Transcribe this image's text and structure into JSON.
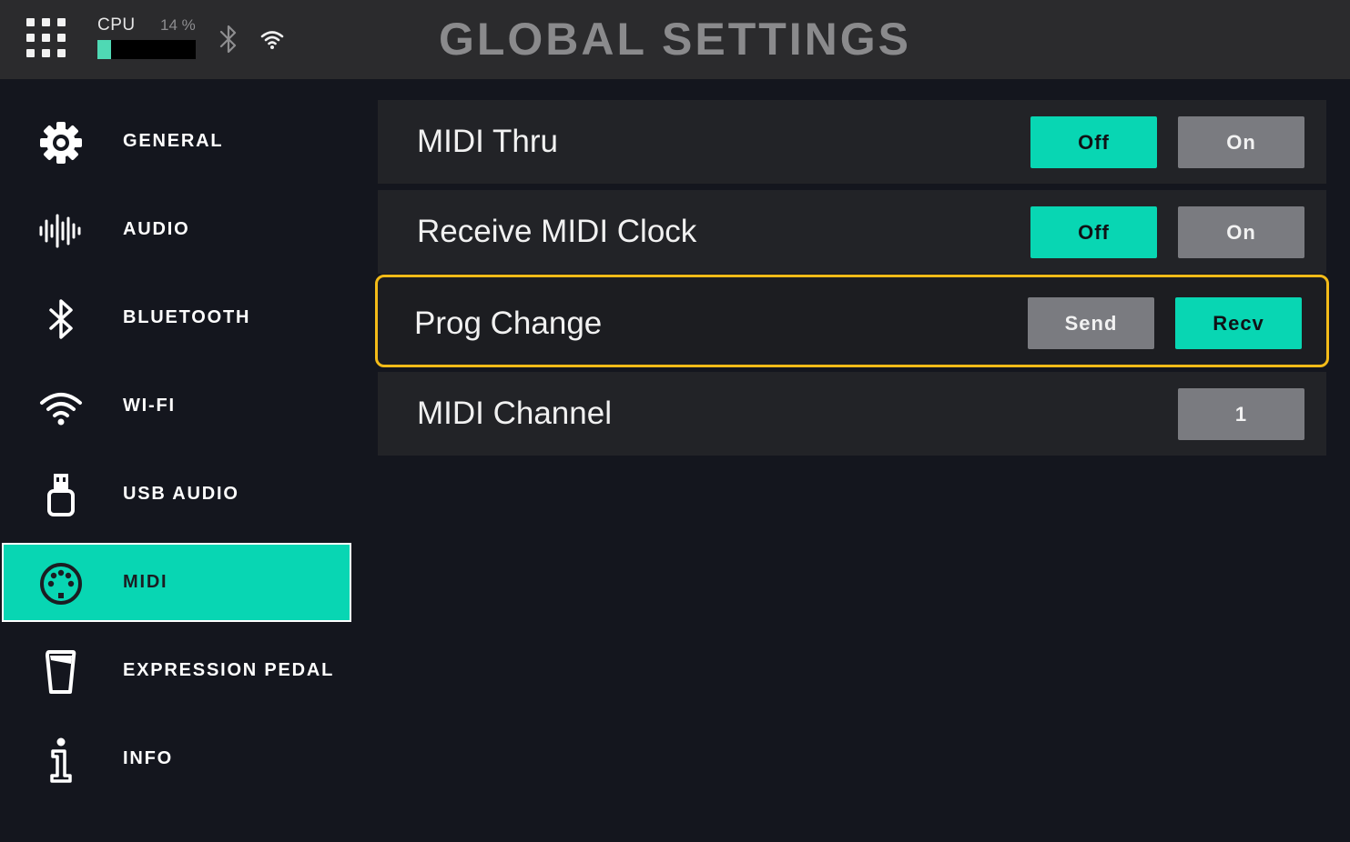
{
  "header": {
    "title": "GLOBAL SETTINGS",
    "apps_icon": "grid-icon",
    "cpu": {
      "label": "CPU",
      "value_text": "14 %",
      "percent": 14,
      "meter_color": "#4fd9b4"
    },
    "status_icons": [
      "bluetooth-icon",
      "wifi-icon"
    ]
  },
  "sidebar": {
    "active_index": 5,
    "active_color": "#08d6b3",
    "items": [
      {
        "label": "GENERAL",
        "icon": "gear-icon"
      },
      {
        "label": "AUDIO",
        "icon": "waveform-icon"
      },
      {
        "label": "BLUETOOTH",
        "icon": "bluetooth-icon"
      },
      {
        "label": "WI-FI",
        "icon": "wifi-icon"
      },
      {
        "label": "USB AUDIO",
        "icon": "usb-icon"
      },
      {
        "label": "MIDI",
        "icon": "midi-connector-icon"
      },
      {
        "label": "EXPRESSION PEDAL",
        "icon": "expression-pedal-icon"
      },
      {
        "label": "INFO",
        "icon": "info-icon"
      }
    ]
  },
  "settings": {
    "highlight_color": "#f3bb18",
    "rows": [
      {
        "label": "MIDI Thru",
        "options": [
          "Off",
          "On"
        ],
        "selected": "Off"
      },
      {
        "label": "Receive MIDI Clock",
        "options": [
          "Off",
          "On"
        ],
        "selected": "Off"
      },
      {
        "label": "Prog Change",
        "options": [
          "Send",
          "Recv"
        ],
        "selected": "Recv",
        "focused": true
      },
      {
        "label": "MIDI Channel",
        "value": "1"
      }
    ]
  }
}
